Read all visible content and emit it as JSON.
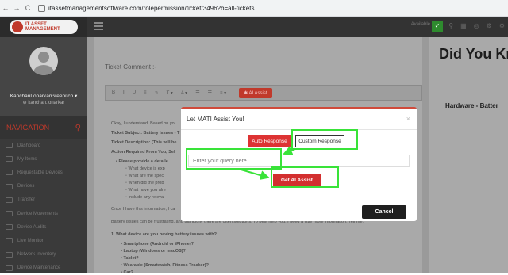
{
  "browser": {
    "back": "←",
    "forward": "→",
    "reload": "C",
    "url": "itassetmanagementsoftware.com/rolepermission/ticket/3496?b=all-tickets"
  },
  "logo": {
    "line1": "IT ASSET",
    "line2": "MANAGEMENT"
  },
  "user": {
    "name": "KanchanLonarkarGreenitco ▾",
    "sub": "⊕ kanchan.lonarkar"
  },
  "nav": {
    "heading": "NAVIGATION",
    "items": [
      "Dashboard",
      "My Items",
      "Requestable Devices",
      "Devices",
      "Transfer",
      "Device Movements",
      "Device Audits",
      "Live Monitor",
      "Network Inventory",
      "Device Maintenance"
    ]
  },
  "topbar": {
    "available": "Available",
    "toggle": "✓"
  },
  "main": {
    "ticket_comment": "Ticket Comment :-",
    "ai_assist": "✱ AI Assist",
    "toolbar": [
      "B",
      "I",
      "U",
      "≡",
      "↰",
      "T ▾",
      "A ▾",
      "☰",
      "☷",
      "≡ ▾"
    ],
    "bg_lines": [
      "Okay, I understand. Based on yo",
      "Ticket Subject: Battery Issues - T",
      "Ticket Description: (This will be",
      "Action Required From You, Sel",
      "• Please provide a detaile",
      "◦ What device is exp",
      "◦ What are the speci",
      "◦ When did the prob",
      "◦ What have you alre",
      "◦ Include any releva",
      "Once I have this information, I ca",
      "Battery issues can be frustrating, and thankfully there are often solutions. To best help you, I need a little more information. Tell me:",
      "1. What device are you having battery issues with?",
      "• Smartphone (Android or iPhone)?",
      "• Laptop (Windows or macOS)?",
      "• Tablet?",
      "• Wearable (Smartwatch, Fitness Tracker)?",
      "• Car?"
    ]
  },
  "right": {
    "headline": "Did You Kn",
    "sub": "Hardware - Batter"
  },
  "modal": {
    "title": "Let MATI Assist You!",
    "close": "×",
    "auto_response": "Auto Response",
    "custom_response": "Custom Response",
    "query_placeholder": "Enter your query here",
    "get_ai_assist": "Get AI Assist",
    "cancel": "Cancel"
  }
}
